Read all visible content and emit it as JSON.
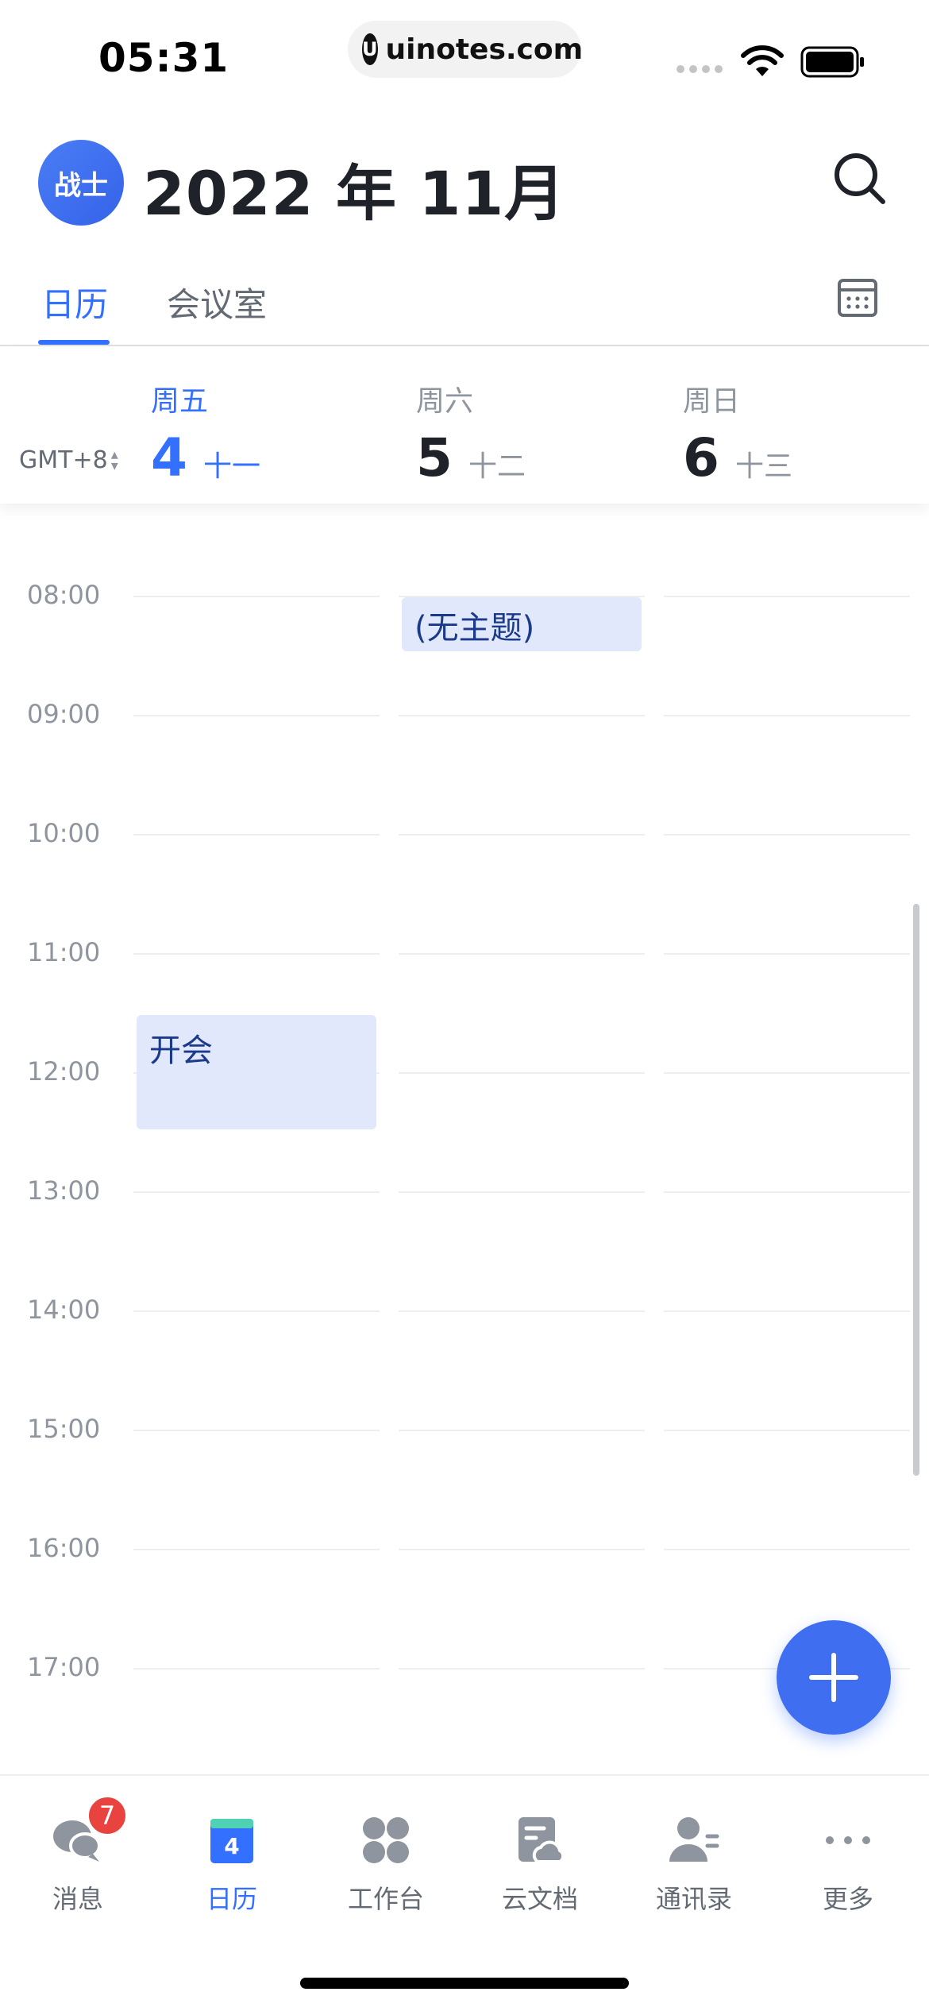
{
  "status_bar": {
    "time": "05:31",
    "url": "uinotes.com",
    "url_logo": "U"
  },
  "header": {
    "avatar_text": "战士",
    "month_title": "2022 年 11月"
  },
  "tabs": [
    {
      "label": "日历",
      "active": true
    },
    {
      "label": "会议室",
      "active": false
    }
  ],
  "day_header": {
    "timezone": "GMT+8",
    "days": [
      {
        "week": "周五",
        "num": "4",
        "lunar": "十一",
        "today": true
      },
      {
        "week": "周六",
        "num": "5",
        "lunar": "十二",
        "today": false
      },
      {
        "week": "周日",
        "num": "6",
        "lunar": "十三",
        "today": false
      }
    ]
  },
  "hours": [
    "08:00",
    "09:00",
    "10:00",
    "11:00",
    "12:00",
    "13:00",
    "14:00",
    "15:00",
    "16:00",
    "17:00"
  ],
  "events": [
    {
      "title": "(无主题)",
      "day": "周六"
    },
    {
      "title": "开会",
      "day": "周五"
    }
  ],
  "bottom_nav": [
    {
      "label": "消息",
      "icon": "chat-icon",
      "badge": "7",
      "active": false
    },
    {
      "label": "日历",
      "icon": "calendar-icon",
      "icon_text": "4",
      "active": true
    },
    {
      "label": "工作台",
      "icon": "workbench-icon",
      "active": false
    },
    {
      "label": "云文档",
      "icon": "cloud-doc-icon",
      "active": false
    },
    {
      "label": "通讯录",
      "icon": "contacts-icon",
      "active": false
    },
    {
      "label": "更多",
      "icon": "more-icon",
      "active": false
    }
  ],
  "colors": {
    "accent": "#3370ff",
    "event_bg": "#e1e8fb",
    "badge": "#e9433f"
  }
}
